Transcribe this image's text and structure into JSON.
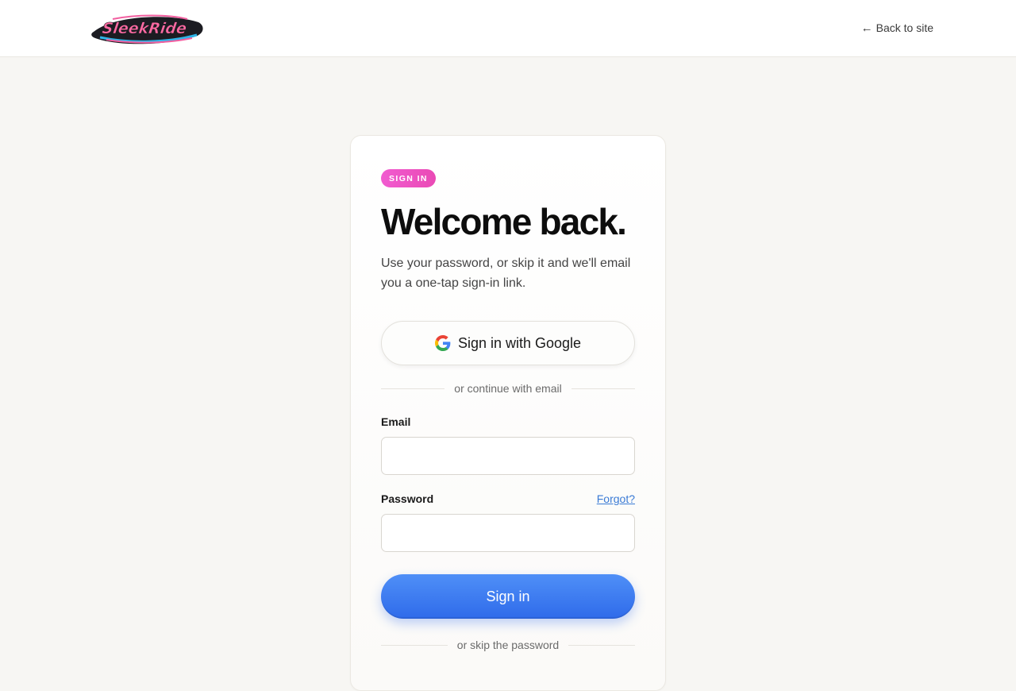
{
  "header": {
    "logo_text": "SleekRide",
    "back_label": "Back to site",
    "back_arrow": "←"
  },
  "card": {
    "badge": "SIGN IN",
    "title": "Welcome back.",
    "subtitle": "Use your password, or skip it and we'll email you a one-tap sign-in link.",
    "google_button_label": "Sign in with Google",
    "divider_email": "or continue with email",
    "email_label": "Email",
    "email_value": "",
    "password_label": "Password",
    "password_value": "",
    "forgot_label": "Forgot?",
    "signin_label": "Sign in",
    "divider_skip": "or skip the password"
  },
  "colors": {
    "background": "#f7f6f3",
    "badge": "#f15bd0",
    "primary": "#3b7cf2",
    "link": "#3a7bd5"
  },
  "icons": {
    "back": "arrow-left-icon",
    "google": "google-g-icon"
  }
}
